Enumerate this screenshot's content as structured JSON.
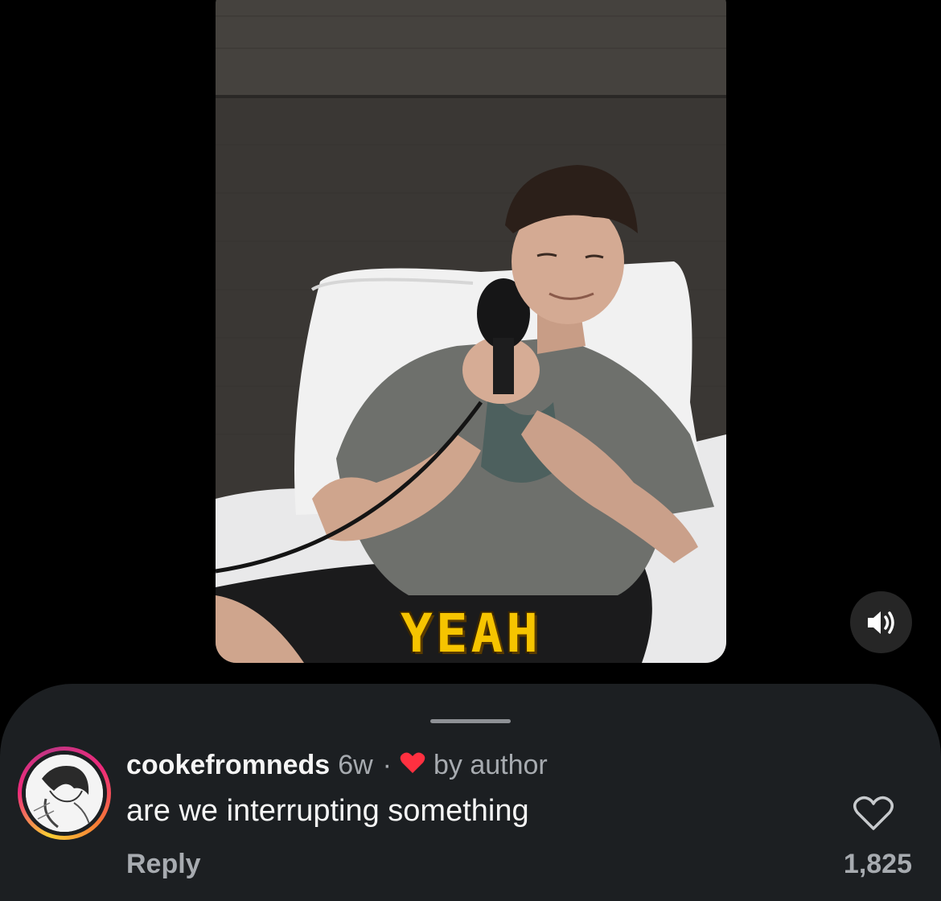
{
  "video": {
    "caption": "YEAH",
    "sound_icon": "speaker-on-icon"
  },
  "comment": {
    "username": "cookefromneds",
    "age": "6w",
    "separator": "·",
    "liked_by_author_icon": "heart-filled-icon",
    "liked_by_author_label": "by author",
    "text": "are we interrupting something",
    "reply_label": "Reply",
    "like_icon": "heart-outline-icon",
    "like_count": "1,825"
  },
  "colors": {
    "background": "#000000",
    "sheet": "#1c1f22",
    "caption": "#f6c400",
    "author_heart": "#ff3040",
    "muted_text": "#a7abb0"
  }
}
